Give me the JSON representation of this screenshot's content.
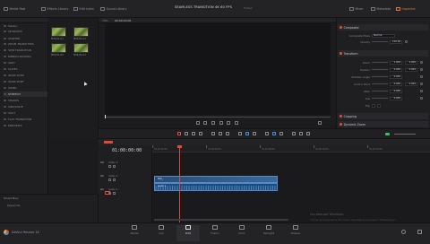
{
  "topbar": {
    "left_buttons": [
      "Media Pool",
      "Effects Library",
      "Edit Index",
      "Sound Library"
    ],
    "title": "SEAMLESS TRANSITION 4K 60 FPS",
    "title_status": "Edited",
    "right_buttons": [
      "Mixer",
      "Metadata",
      "Inspector"
    ]
  },
  "bin": {
    "header": "Master",
    "items": [
      {
        "label": "Master"
      },
      {
        "label": "SEAMLESS"
      },
      {
        "label": "STARTER"
      },
      {
        "label": "ZOOM TRANSITION"
      },
      {
        "label": "SPIN TRANSITION"
      },
      {
        "label": "RIBBON PACKING"
      },
      {
        "label": "GRID"
      },
      {
        "label": "SLIDES"
      },
      {
        "label": "WARP LOOK"
      },
      {
        "label": "WARP PORT"
      },
      {
        "label": "SWIRL"
      },
      {
        "label": "STRETCH"
      },
      {
        "label": "SHAKES"
      },
      {
        "label": "SINUSOIDE"
      },
      {
        "label": "SPLIT"
      },
      {
        "label": "FLAT TRANSITION"
      },
      {
        "label": "PREVIEWS"
      }
    ],
    "selected_index": 11,
    "smart_bins": [
      "Smart Bins",
      "Keywords"
    ]
  },
  "clips": [
    {
      "label": "MP4/01-01"
    },
    {
      "label": "MP4/01-02"
    },
    {
      "label": "MP4/01-02"
    },
    {
      "label": "MP4/01-01"
    }
  ],
  "viewer": {
    "timecode": "00:00:00:00",
    "zoom": "70%"
  },
  "inspector": {
    "sections": [
      {
        "title": "Composite"
      },
      {
        "title": "Transform"
      },
      {
        "title": "Cropping"
      },
      {
        "title": "Dynamic Zoom"
      }
    ],
    "composite_rows": [
      {
        "label": "Composite Mode",
        "value": "Normal"
      },
      {
        "label": "Opacity",
        "value": "100.00"
      }
    ],
    "transform_rows": [
      {
        "label": "Zoom",
        "x": "1.000",
        "y": "1.000"
      },
      {
        "label": "Position",
        "x": "0.000",
        "y": "0.000"
      },
      {
        "label": "Rotation Angle",
        "x": "0.000",
        "y": ""
      },
      {
        "label": "Anchor Point",
        "x": "0.000",
        "y": "0.000"
      },
      {
        "label": "Pitch",
        "x": "0.000",
        "y": ""
      },
      {
        "label": "Yaw",
        "x": "0.000",
        "y": ""
      },
      {
        "label": "Flip",
        "x": "",
        "y": ""
      }
    ]
  },
  "timeline": {
    "timecode": "01:00:00:00",
    "ruler_labels": [
      "01:00:00:00",
      "01:00:04:00",
      "01:00:08:00",
      "01:00:12:00",
      "01:00:16:00"
    ],
    "tracks": [
      {
        "badge": "V2",
        "name": "Video 2"
      },
      {
        "badge": "V1",
        "name": "Video 1"
      },
      {
        "badge": "A1",
        "name": "Audio 1"
      }
    ],
    "clip_v1": "SEQ_",
    "clip_a1": "Audio 1"
  },
  "bottom": {
    "app_name": "DaVinci Resolve 18",
    "pages": [
      "Media",
      "Cut",
      "Edit",
      "Fusion",
      "Color",
      "Fairlight",
      "Deliver"
    ],
    "active_page": "Edit"
  },
  "watermark": {
    "line1": "Активация Windows",
    "line2": "Чтобы активировать Windows, перейдите в раздел \"Параметры\"."
  },
  "colors": {
    "accent": "#e07a3a",
    "playhead": "#e04a3a",
    "clip": "#3a6a9a"
  }
}
